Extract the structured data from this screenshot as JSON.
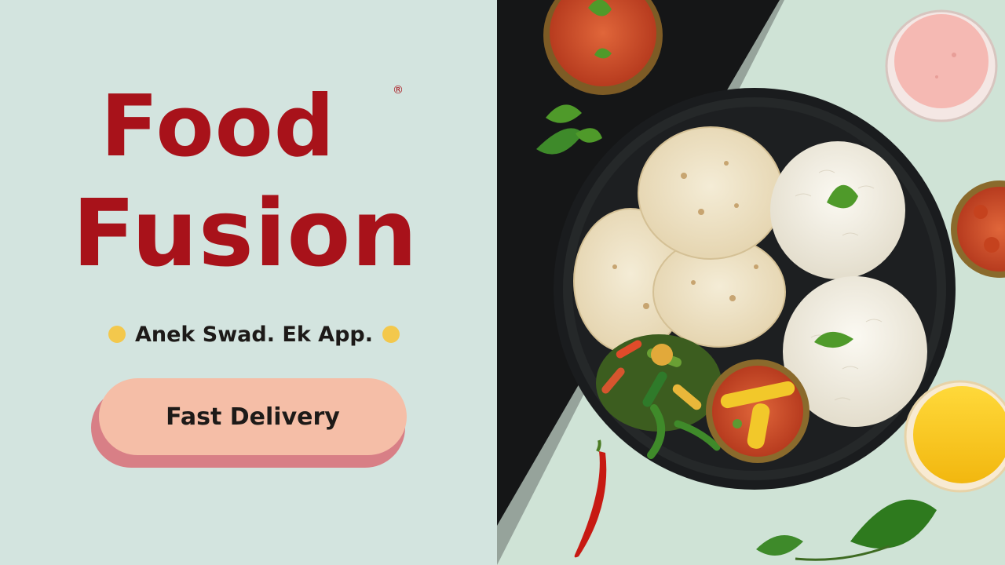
{
  "brand": {
    "line1": "Food",
    "line2": "Fusion",
    "registered_mark": "®",
    "color": "#a8121a"
  },
  "tagline": {
    "text": "Anek Swad. Ek App.",
    "dot_color": "#f3c84c"
  },
  "cta": {
    "label": "Fast Delivery",
    "color": "#f5bea7",
    "shadow_color": "#d87f86"
  },
  "icons": [
    "food-thali-photo"
  ]
}
